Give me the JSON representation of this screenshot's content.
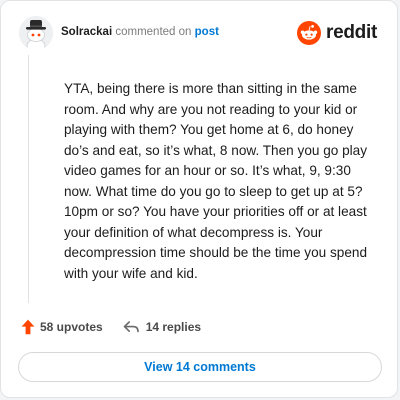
{
  "header": {
    "username": "Solrackai",
    "action_text": "commented on",
    "post_link": "post",
    "brand_name": "reddit",
    "avatar_icon": "snoo-avatar-icon",
    "brand_icon": "reddit-logo-icon"
  },
  "comment": {
    "text": "YTA, being there is more than sitting in the same room. And why are you not reading to your kid or playing with them? You get home at 6, do honey do’s and eat, so it’s what, 8 now. Then you go play video games for an hour or so. It’s what, 9, 9:30 now. What time do you go to sleep to get up at 5? 10pm or so? You have your priorities off or at least your definition of what decompress is. Your decompression time should be the time you spend with your wife and kid."
  },
  "actions": {
    "upvotes_label": "58 upvotes",
    "replies_label": "14 replies",
    "upvote_icon": "upvote-arrow-icon",
    "reply_icon": "reply-arrow-icon"
  },
  "view_button": {
    "label": "View 14 comments"
  },
  "colors": {
    "brand": "#ff4500",
    "link": "#0079d3",
    "text": "#1c1c1c",
    "muted": "#7c7c7c"
  }
}
